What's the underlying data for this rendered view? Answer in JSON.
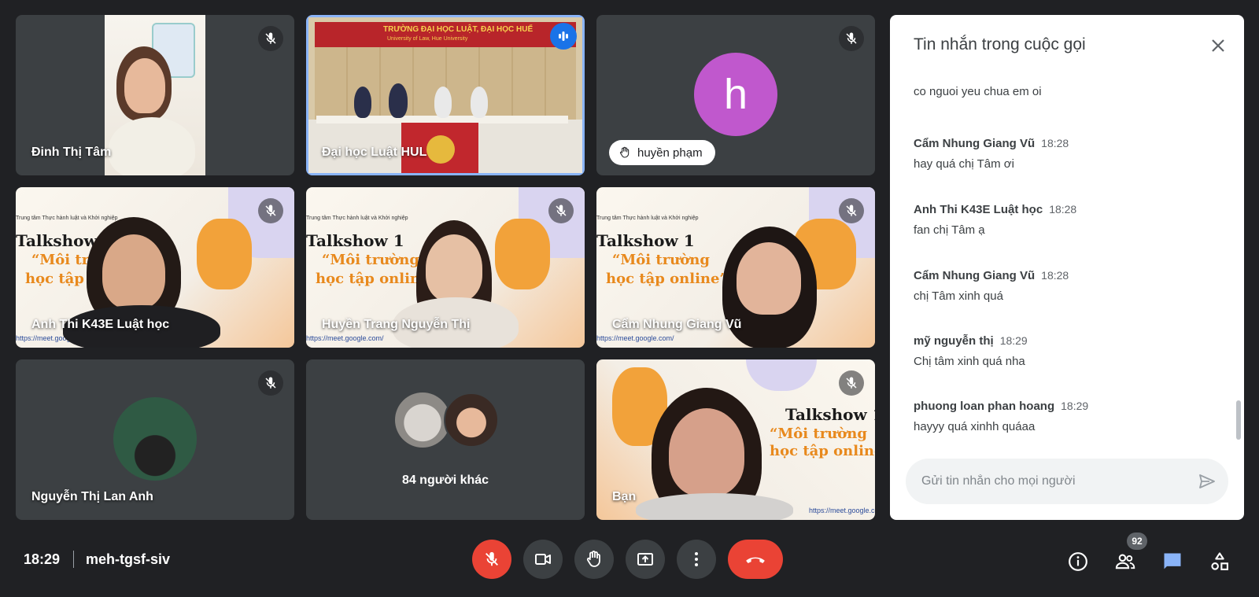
{
  "tiles": {
    "t1": {
      "name": "Đinh Thị Tâm"
    },
    "t2": {
      "name": "Đại học Luật HUL",
      "banner": "TRƯỜNG ĐẠI HỌC LUẬT, ĐẠI HỌC HUẾ",
      "banner_sub": "University of Law, Hue University"
    },
    "t3": {
      "name": "huyền phạm",
      "avatar_letter": "h",
      "avatar_color": "#c058cd"
    },
    "t4": {
      "name": "Anh Thi K43E Luật học"
    },
    "t5": {
      "name": "Huyền Trang Nguyễn Thị"
    },
    "t6": {
      "name": "Cẩm Nhung Giang Vũ"
    },
    "t7": {
      "name": "Nguyễn Thị Lan Anh"
    },
    "t8": {
      "name": "84 người khác"
    },
    "t9": {
      "name": "Bạn"
    }
  },
  "poster": {
    "org": "Trung tâm Thực hành luật và Khởi nghiệp",
    "title": "Talkshow 1",
    "line1": "“Môi trường",
    "line2": "học tập online”",
    "url": "https://meet.google.com/"
  },
  "chat": {
    "title": "Tin nhắn trong cuộc gọi",
    "placeholder": "Gửi tin nhắn cho mọi người",
    "partial": "co nguoi yeu chua em oi",
    "messages": [
      {
        "sender": "Cẩm Nhung Giang Vũ",
        "time": "18:28",
        "text": "hay quá chị Tâm ơi"
      },
      {
        "sender": "Anh Thi K43E Luật học",
        "time": "18:28",
        "text": "fan chị Tâm ạ"
      },
      {
        "sender": "Cẩm Nhung Giang Vũ",
        "time": "18:28",
        "text": "chị Tâm xinh quá"
      },
      {
        "sender": "mỹ nguyễn thị",
        "time": "18:29",
        "text": "Chị tâm xinh quá nha"
      },
      {
        "sender": "phuong loan phan hoang",
        "time": "18:29",
        "text": "hayyy quá xinhh quáaa"
      }
    ]
  },
  "bar": {
    "clock": "18:29",
    "meeting_code": "meh-tgsf-siv",
    "participants_count": "92"
  },
  "colors": {
    "end_call": "#ea4335",
    "accent": "#1a73e8",
    "chat_icon": "#8ab4f8"
  }
}
